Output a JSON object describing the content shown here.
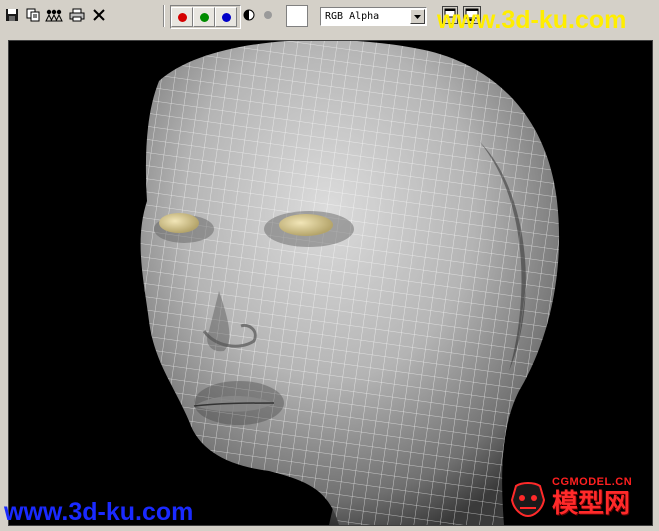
{
  "toolbar": {
    "save_icon": "save-icon",
    "copy_icon": "copy-icon",
    "clone_icon": "clone-icon",
    "print_icon": "print-icon",
    "clear_icon": "close-icon",
    "channels": [
      {
        "name": "red-channel",
        "color": "#d40000"
      },
      {
        "name": "green-channel",
        "color": "#008c00"
      },
      {
        "name": "blue-channel",
        "color": "#0000c8"
      }
    ],
    "mono_icon": "half-circle-icon",
    "dot_icon": "dot-icon",
    "swatch_color": "#ffffff",
    "display_mode": "RGB Alpha"
  },
  "watermarks": {
    "top": "www.3d-ku.com",
    "bottom": "www.3d-ku.com",
    "logo_small": "CGMODEL.CN",
    "logo_main": "模型网"
  },
  "colors": {
    "watermark_top": "#ffee00",
    "watermark_bottom": "#1a2aff",
    "logo": "#ff2a2a"
  }
}
